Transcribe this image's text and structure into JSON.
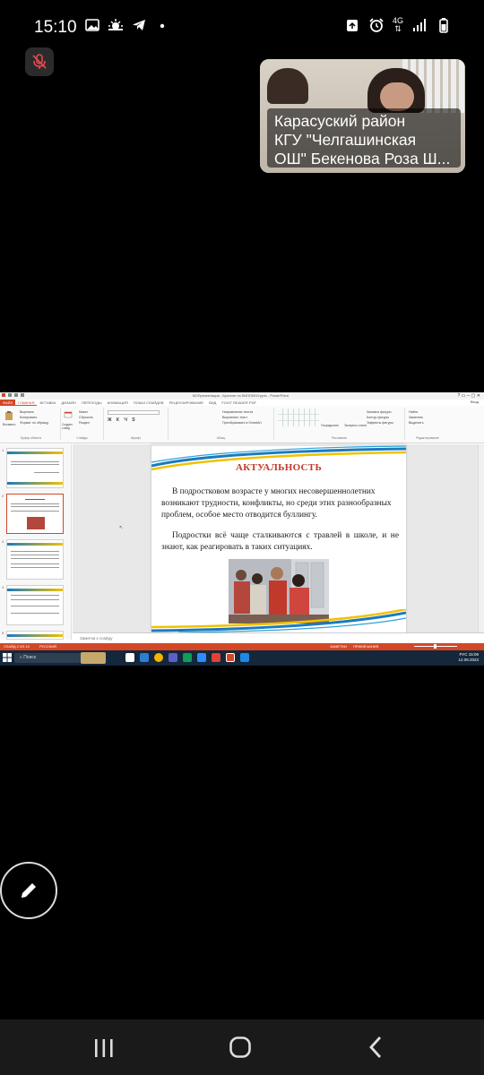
{
  "status_bar": {
    "time": "15:10",
    "left_icons": [
      "image-icon",
      "weather-icon",
      "telegram-icon",
      "dot-icon"
    ],
    "right_icons": [
      "recycle-icon",
      "alarm-icon",
      "4g-icon",
      "signal-icon",
      "battery-icon"
    ],
    "network_label": "4G"
  },
  "call": {
    "mic_state": "muted",
    "participant_name": "Карасуский район\nКГУ \"Челгашинская\nОШ\" Бекенова Роза Ш..."
  },
  "shared_screen": {
    "window_title": "ВОПрезентация - Буллинг по ВЧПОМЧУ.pptx - PowerPoint",
    "user_label": "Вход",
    "ribbon_tabs": [
      "ФАЙЛ",
      "ГЛАВНАЯ",
      "ВСТАВКА",
      "ДИЗАЙН",
      "ПЕРЕХОДЫ",
      "АНИМАЦИЯ",
      "ПОКАЗ СЛАЙДОВ",
      "РЕЦЕНЗИРОВАНИЕ",
      "ВИД",
      "FOXIT READER PDF"
    ],
    "active_tab": "ГЛАВНАЯ",
    "ribbon_groups": {
      "clipboard": {
        "label": "Буфер обмена",
        "items": [
          "Вырезать",
          "Копировать",
          "Формат по образцу"
        ],
        "paste": "Вставить"
      },
      "slides": {
        "label": "Слайды",
        "items": [
          "Макет",
          "Сбросить",
          "Раздел"
        ],
        "new_slide": "Создать слайд"
      },
      "font": {
        "label": "Шрифт"
      },
      "paragraph": {
        "label": "Абзац",
        "items": [
          "Направление текста",
          "Выровнять текст",
          "Преобразовать в SmartArt"
        ]
      },
      "drawing": {
        "label": "Рисование",
        "items": [
          "Упорядочить",
          "Экспресс-стили",
          "Заливка фигуры",
          "Контур фигуры",
          "Эффекты фигуры"
        ]
      },
      "editing": {
        "label": "Редактирование",
        "items": [
          "Найти",
          "Заменить",
          "Выделить"
        ]
      }
    },
    "thumbnails": [
      {
        "num": "1"
      },
      {
        "num": "2"
      },
      {
        "num": "3"
      },
      {
        "num": "4"
      },
      {
        "num": "5"
      }
    ],
    "slide": {
      "title": "АКТУАЛЬНОСТЬ",
      "paragraph1": "В подростковом возрасте у многих несовершеннолетних возникают трудности, конфликты,  но среди этих разнообразных проблем, особое место отводится буллингу.",
      "paragraph2": "Подростки всё чаще сталкиваются с травлей в школе, и не знают, как реагировать в таких ситуациях."
    },
    "notes_placeholder": "Заметки к слайду",
    "statusbar_left": "СЛАЙД 2 ИЗ 10",
    "statusbar_lang": "РУССКИЙ",
    "statusbar_notes": "ЗАМЕТКИ",
    "statusbar_comments": "ПРИМЕЧАНИЯ",
    "taskbar_search": "Поиск",
    "tray_lang": "РУС",
    "tray_time": "15:09",
    "tray_date": "12.09.2023"
  },
  "colors": {
    "powerpoint_accent": "#d24726",
    "slide_title": "#c0392b",
    "taskbar": "#14273b",
    "nav_bar": "#1a1a1a"
  }
}
